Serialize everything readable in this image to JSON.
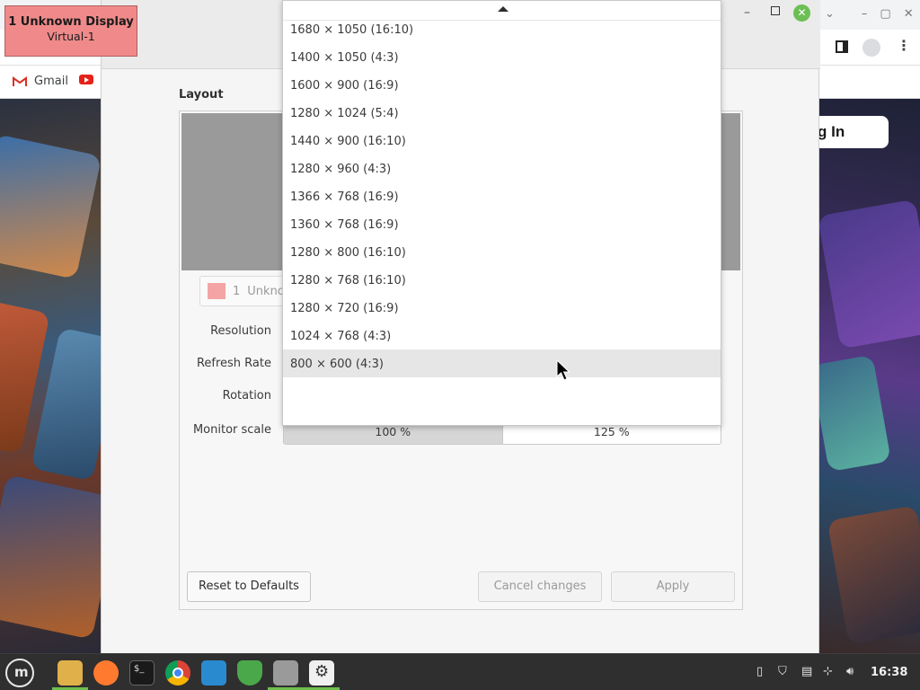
{
  "osd": {
    "line1": "1  Unknown Display",
    "line2": "Virtual-1"
  },
  "bookmarks": [
    {
      "label": "Gmail",
      "icon": "gmail-icon"
    },
    {
      "label": "",
      "icon": "youtube-icon"
    }
  ],
  "page_button": {
    "label": "g In"
  },
  "dialog": {
    "layout_title": "Layout",
    "monitor_chip": {
      "index": "1",
      "name": "Unkno"
    },
    "fields": {
      "resolution": "Resolution",
      "refresh_rate": "Refresh Rate",
      "rotation": "Rotation",
      "monitor_scale": "Monitor scale"
    },
    "scale_options": [
      "100 %",
      "125 %"
    ],
    "scale_selected": "100 %",
    "buttons": {
      "reset": "Reset to Defaults",
      "cancel": "Cancel changes",
      "apply": "Apply"
    }
  },
  "resolution_dropdown": {
    "items": [
      "1680 × 1050 (16:10)",
      "1400 × 1050 (4:3)",
      "1600 × 900 (16:9)",
      "1280 × 1024 (5:4)",
      "1440 × 900 (16:10)",
      "1280 × 960 (4:3)",
      "1366 × 768 (16:9)",
      "1360 × 768 (16:9)",
      "1280 × 800 (16:10)",
      "1280 × 768 (16:10)",
      "1280 × 720 (16:9)",
      "1024 × 768 (4:3)",
      "800 × 600 (4:3)"
    ],
    "hovered": "800 × 600 (4:3)"
  },
  "taskbar": {
    "apps": [
      "mint-menu-icon",
      "files-icon",
      "firefox-icon",
      "terminal-icon",
      "chrome-icon",
      "system-monitor-icon",
      "shield-icon",
      "settings-toggle-icon",
      "gear-icon"
    ],
    "clock": "16:38"
  },
  "colors": {
    "osd": "#f08a8a",
    "preview": "#9a9a9a",
    "taskbar": "#2f2f2f",
    "accent_green": "#6fbf4f"
  }
}
